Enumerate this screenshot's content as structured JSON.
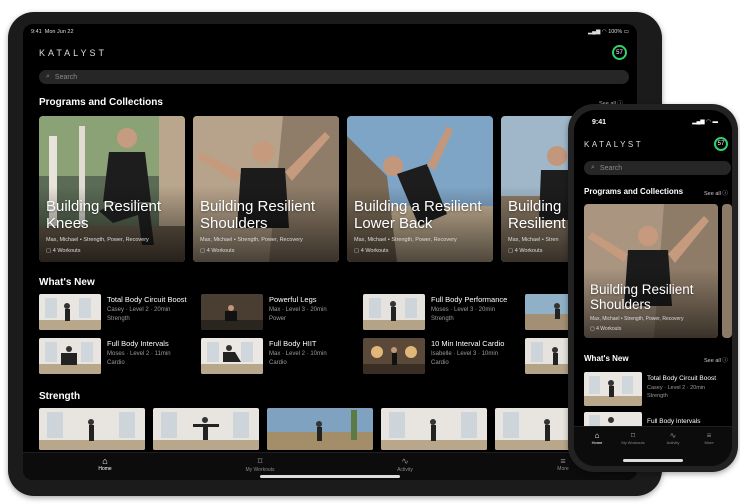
{
  "tablet": {
    "status": {
      "time": "9:41",
      "date": "Mon Jun 22",
      "battery": "100%"
    },
    "brand": "KATALYST",
    "ring_value": "57",
    "search_placeholder": "Search",
    "programs": {
      "title": "Programs and Collections",
      "see_all": "See all",
      "cards": [
        {
          "title_1": "Building Resilient",
          "title_2": "Knees",
          "meta": "Max, Michael • Strength, Power, Recovery",
          "workouts": "4 Workouts"
        },
        {
          "title_1": "Building Resilient",
          "title_2": "Shoulders",
          "meta": "Max, Michael • Strength, Power, Recovery",
          "workouts": "4 Workouts"
        },
        {
          "title_1": "Building a Resilient",
          "title_2": "Lower Back",
          "meta": "Max, Michael • Strength, Power, Recovery",
          "workouts": "4 Workouts"
        },
        {
          "title_1": "Building",
          "title_2": "Resilient",
          "meta": "Max, Michael • Stren",
          "workouts": "4 Workouts"
        }
      ]
    },
    "whats_new": {
      "title": "What's New",
      "items": [
        {
          "title": "Total Body Circuit Boost",
          "line1": "Casey · Level 2 · 20min",
          "line2": "Strength"
        },
        {
          "title": "Powerful Legs",
          "line1": "Max · Level 3 · 20min",
          "line2": "Power"
        },
        {
          "title": "Full Body Performance",
          "line1": "Moses · Level 3 · 20min",
          "line2": "Strength"
        },
        {
          "title": "Full Body Intervals",
          "line1": "Moses · Level 2 · 11min",
          "line2": "Cardio"
        },
        {
          "title": "Full Body HIIT",
          "line1": "Max · Level 2 · 10min",
          "line2": "Cardio"
        },
        {
          "title": "10 Min Interval Cardio",
          "line1": "Isabelle · Level 3 · 10min",
          "line2": "Cardio"
        }
      ]
    },
    "strength": {
      "title": "Strength"
    },
    "tabs": [
      {
        "label": "Home",
        "icon": "home-icon"
      },
      {
        "label": "My Workouts",
        "icon": "bookmark-icon"
      },
      {
        "label": "Activity",
        "icon": "activity-icon"
      },
      {
        "label": "More",
        "icon": "menu-icon"
      }
    ]
  },
  "phone": {
    "status": {
      "time": "9:41"
    },
    "brand": "KATALYST",
    "ring_value": "57",
    "search_placeholder": "Search",
    "programs": {
      "title": "Programs and Collections",
      "see_all": "See all",
      "card": {
        "title_1": "Building Resilient",
        "title_2": "Shoulders",
        "meta": "Max, Michael • Strength, Power, Recovery",
        "workouts": "4 Workouts"
      }
    },
    "whats_new": {
      "title": "What's New",
      "see_all": "See all",
      "items": [
        {
          "title": "Total Body Circuit Boost",
          "line1": "Casey · Level 2 · 20min",
          "line2": "Strength"
        },
        {
          "title": "Full Body Intervals"
        }
      ]
    },
    "tabs": [
      {
        "label": "Home"
      },
      {
        "label": "My Workouts"
      },
      {
        "label": "Activity"
      },
      {
        "label": "More"
      }
    ]
  },
  "colors": {
    "ring": "#2fd26b",
    "background": "#000000",
    "accent_text": "#ffffff"
  }
}
